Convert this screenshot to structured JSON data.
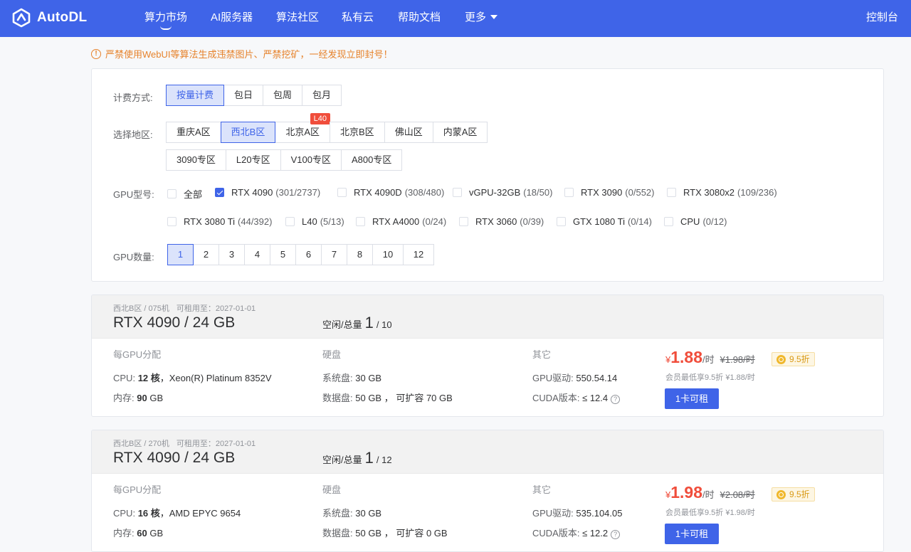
{
  "header": {
    "brand": "AutoDL",
    "nav": [
      "算力市场",
      "AI服务器",
      "算法社区",
      "私有云",
      "帮助文档",
      "更多"
    ],
    "console": "控制台"
  },
  "notice": "严禁使用WebUI等算法生成违禁图片、严禁挖矿，一经发现立即封号！",
  "filters": {
    "billing_label": "计费方式:",
    "billing": [
      "按量计费",
      "包日",
      "包周",
      "包月"
    ],
    "region_label": "选择地区:",
    "regions_row1": [
      "重庆A区",
      "西北B区",
      "北京A区",
      "北京B区",
      "佛山区",
      "内蒙A区"
    ],
    "regions_row2": [
      "3090专区",
      "L20专区",
      "V100专区",
      "A800专区"
    ],
    "region_badge": "L40",
    "gpu_label": "GPU型号:",
    "gpus": [
      {
        "name": "全部",
        "count": ""
      },
      {
        "name": "RTX 4090",
        "count": "(301/2737)"
      },
      {
        "name": "RTX 4090D",
        "count": "(308/480)"
      },
      {
        "name": "vGPU-32GB",
        "count": "(18/50)"
      },
      {
        "name": "RTX 3090",
        "count": "(0/552)"
      },
      {
        "name": "RTX 3080x2",
        "count": "(109/236)"
      },
      {
        "name": "RTX 3080 Ti",
        "count": "(44/392)"
      },
      {
        "name": "L40",
        "count": "(5/13)"
      },
      {
        "name": "RTX A4000",
        "count": "(0/24)"
      },
      {
        "name": "RTX 3060",
        "count": "(0/39)"
      },
      {
        "name": "GTX 1080 Ti",
        "count": "(0/14)"
      },
      {
        "name": "CPU",
        "count": "(0/12)"
      }
    ],
    "gpu_count_label": "GPU数量:",
    "gpu_counts": [
      "1",
      "2",
      "3",
      "4",
      "5",
      "6",
      "7",
      "8",
      "10",
      "12"
    ]
  },
  "labels": {
    "idle_total": "空闲/总量",
    "per_gpu": "每GPU分配",
    "disk": "硬盘",
    "other": "其它",
    "cpu_key": "CPU:",
    "mem_key": "内存:",
    "sys_disk_key": "系统盘:",
    "data_disk_key": "数据盘:",
    "driver_key": "GPU驱动:",
    "cuda_key": "CUDA版本:",
    "currency": "¥",
    "per_hour": "/时",
    "help": "?"
  },
  "machines": [
    {
      "region": "西北B区 / 075机",
      "until": "可租用至：2027-01-01",
      "model": "RTX 4090 / 24 GB",
      "idle": "1",
      "total": "/ 10",
      "cpu_cores": "12 核",
      "cpu_model": "，Xeon(R) Platinum 8352V",
      "mem_value": "90",
      "mem_unit": " GB",
      "sys_disk": "30 GB",
      "data_disk": "50 GB ， 可扩容 70 GB",
      "driver": "550.54.14",
      "cuda": "≤ 12.4",
      "price": "1.88",
      "old_price": "¥1.98/时",
      "discount": "9.5折",
      "member": "会员最低享9.5折 ¥1.88/时",
      "rent": "1卡可租"
    },
    {
      "region": "西北B区 / 270机",
      "until": "可租用至：2027-01-01",
      "model": "RTX 4090 / 24 GB",
      "idle": "1",
      "total": "/ 12",
      "cpu_cores": "16 核",
      "cpu_model": "，AMD EPYC 9654",
      "mem_value": "60",
      "mem_unit": " GB",
      "sys_disk": "30 GB",
      "data_disk": "50 GB ， 可扩容 0 GB",
      "driver": "535.104.05",
      "cuda": "≤ 12.2",
      "price": "1.98",
      "old_price": "¥2.08/时",
      "discount": "9.5折",
      "member": "会员最低享9.5折 ¥1.98/时",
      "rent": "1卡可租"
    }
  ]
}
